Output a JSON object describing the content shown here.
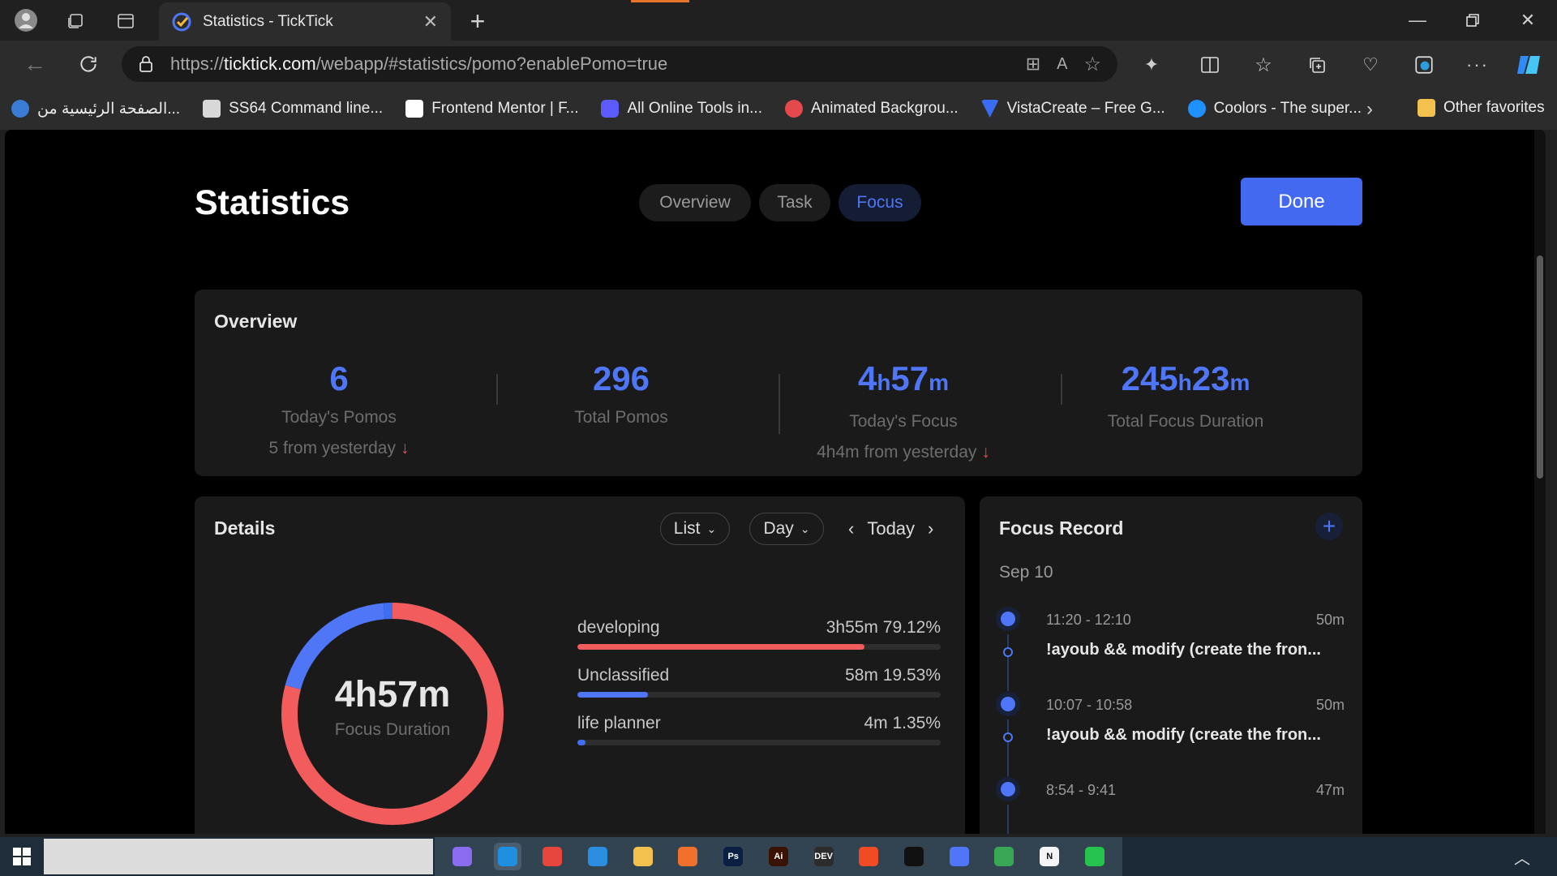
{
  "browser": {
    "tab_title": "Statistics - TickTick",
    "url_prefix": "https://",
    "url_host": "ticktick.com",
    "url_path": "/webapp/#statistics/pomo?enablePomo=true",
    "bookmarks": [
      {
        "label": "الصفحة الرئيسية من...",
        "icon": "msn-icon",
        "color": "#3a7bd5"
      },
      {
        "label": "SS64 Command line...",
        "icon": "ss64-icon",
        "color": "#d8d8d8"
      },
      {
        "label": "Frontend Mentor | F...",
        "icon": "frontend-mentor-icon",
        "color": "#ffffff"
      },
      {
        "label": "All Online Tools in...",
        "icon": "online-tools-icon",
        "color": "#5b5bff"
      },
      {
        "label": "Animated Backgrou...",
        "icon": "animated-bg-icon",
        "color": "#e5484d"
      },
      {
        "label": "VistaCreate – Free G...",
        "icon": "vistacreate-icon",
        "color": "#3a6cf4"
      },
      {
        "label": "Coolors - The super...",
        "icon": "coolors-icon",
        "color": "#1e90ff"
      }
    ],
    "other_favorites": "Other favorites"
  },
  "page": {
    "title": "Statistics",
    "tabs": [
      {
        "label": "Overview",
        "active": false
      },
      {
        "label": "Task",
        "active": false
      },
      {
        "label": "Focus",
        "active": true
      }
    ],
    "done_label": "Done"
  },
  "overview": {
    "title": "Overview",
    "stats": [
      {
        "value": "6",
        "label": "Today's Pomos",
        "compare": "5 from yesterday"
      },
      {
        "value": "296",
        "label": "Total Pomos",
        "compare": ""
      },
      {
        "value_h": "4",
        "unit_h": "h",
        "value_m": "57",
        "unit_m": "m",
        "label": "Today's Focus",
        "compare": "4h4m from yesterday"
      },
      {
        "value_h": "245",
        "unit_h": "h",
        "value_m": "23",
        "unit_m": "m",
        "label": "Total Focus Duration",
        "compare": ""
      }
    ]
  },
  "details": {
    "title": "Details",
    "view_select": "List",
    "range_select": "Day",
    "period_label": "Today",
    "total": "4h57m",
    "total_label": "Focus Duration",
    "items": [
      {
        "name": "developing",
        "value": "3h55m 79.12%",
        "percent": 79.12,
        "color": "#f25c5c"
      },
      {
        "name": "Unclassified",
        "value": "58m 19.53%",
        "percent": 19.53,
        "color": "#4f76f6"
      },
      {
        "name": "life planner",
        "value": "4m 1.35%",
        "percent": 1.35,
        "color": "#3d6ff0"
      }
    ]
  },
  "focus_record": {
    "title": "Focus Record",
    "date": "Sep 10",
    "records": [
      {
        "time": "11:20 - 12:10",
        "duration": "50m",
        "name": "!ayoub && modify (create the fron..."
      },
      {
        "time": "10:07 - 10:58",
        "duration": "50m",
        "name": "!ayoub && modify (create the fron..."
      },
      {
        "time": "8:54 - 9:41",
        "duration": "47m",
        "name": ""
      }
    ]
  },
  "taskbar": {
    "apps": [
      "copilot-icon",
      "edge-icon",
      "chrome-icon",
      "vscode-icon",
      "file-explorer-icon",
      "firefox-icon",
      "photoshop-icon",
      "illustrator-icon",
      "dev-icon",
      "brave-icon",
      "capcut-icon",
      "ticktick-icon",
      "chrome-profile-icon",
      "notion-icon",
      "whatsapp-icon"
    ],
    "app_labels": [
      "",
      "",
      "",
      "",
      "",
      "",
      "Ps",
      "Ai",
      "DEV",
      "",
      "",
      "",
      "",
      "N",
      ""
    ]
  }
}
